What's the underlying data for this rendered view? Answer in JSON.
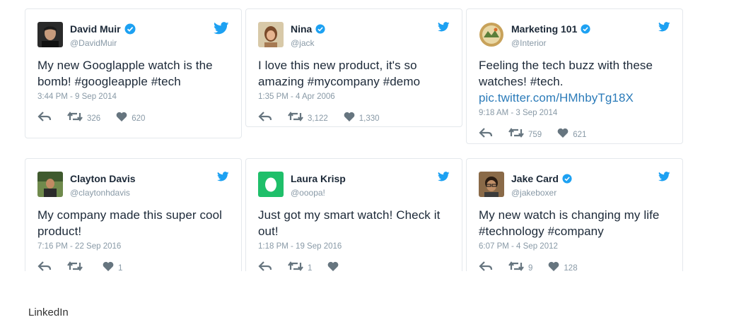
{
  "brand_color": "#1da1f2",
  "tweets": [
    {
      "name": "David Muir",
      "handle": "@DavidMuir",
      "verified": true,
      "text": "My new Googlapple watch is the bomb! #googleapple #tech",
      "link": "",
      "time": "3:44 PM - 9 Sep 2014",
      "retweets": "326",
      "likes": "620"
    },
    {
      "name": "Nina",
      "handle": "@jack",
      "verified": true,
      "text": "I love this new product, it's so amazing #mycompany #demo",
      "link": "",
      "time": "1:35 PM - 4 Apr 2006",
      "retweets": "3,122",
      "likes": "1,330"
    },
    {
      "name": "Marketing 101",
      "handle": "@Interior",
      "verified": true,
      "text": "Feeling the tech buzz with these watches! #tech.",
      "link": "pic.twitter.com/HMhbyTg18X",
      "time": "9:18 AM - 3 Sep 2014",
      "retweets": "759",
      "likes": "621"
    },
    {
      "name": "Clayton Davis",
      "handle": "@claytonhdavis",
      "verified": false,
      "text": "My company made this super cool product!",
      "link": "",
      "time": "7:16 PM - 22 Sep 2016",
      "retweets": "",
      "likes": "1"
    },
    {
      "name": "Laura Krisp",
      "handle": "@ooopa!",
      "verified": false,
      "text": "Just got my smart watch! Check it out!",
      "link": "",
      "time": "1:18 PM - 19 Sep 2016",
      "retweets": "1",
      "likes": ""
    },
    {
      "name": "Jake Card",
      "handle": "@jakeboxer",
      "verified": true,
      "text": "My new watch is changing my life #technology #company",
      "link": "",
      "time": "6:07 PM - 4 Sep 2012",
      "retweets": "9",
      "likes": "128"
    }
  ],
  "footer": {
    "label": "LinkedIn"
  },
  "icons": {
    "brand": "twitter-bird-icon",
    "verified": "verified-badge-icon",
    "reply": "reply-icon",
    "retweet": "retweet-icon",
    "like": "heart-icon"
  }
}
